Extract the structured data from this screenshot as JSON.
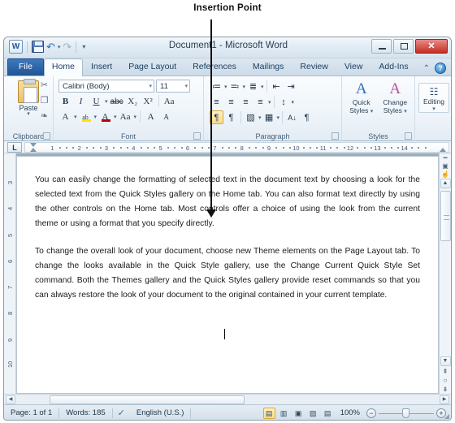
{
  "annotation": {
    "label": "Insertion Point"
  },
  "window": {
    "title": "Document1  -  Microsoft Word",
    "quick_access": [
      {
        "name": "word-logo-icon",
        "label": "W"
      },
      {
        "name": "save-icon",
        "label": "Save"
      },
      {
        "name": "undo-icon",
        "label": "↶"
      },
      {
        "name": "redo-icon",
        "label": "↷"
      },
      {
        "name": "customize-qat-icon",
        "label": "▾"
      }
    ],
    "controls": {
      "minimize": "Minimize",
      "restore": "Restore Down",
      "close": "✕"
    }
  },
  "ribbon": {
    "tabs": [
      {
        "label": "File",
        "active": false,
        "is_file": true
      },
      {
        "label": "Home",
        "active": true
      },
      {
        "label": "Insert",
        "active": false
      },
      {
        "label": "Page Layout",
        "active": false
      },
      {
        "label": "References",
        "active": false
      },
      {
        "label": "Mailings",
        "active": false
      },
      {
        "label": "Review",
        "active": false
      },
      {
        "label": "View",
        "active": false
      },
      {
        "label": "Add-Ins",
        "active": false
      }
    ],
    "minimize_ribbon_icon": "⌃",
    "help_label": "?",
    "groups": {
      "clipboard": {
        "label": "Clipboard",
        "paste_label": "Paste",
        "paste_caret": "▾",
        "cut_icon": "✂",
        "copy_icon": "❐",
        "format_painter_icon": "❧",
        "dialog_launcher": "⌐"
      },
      "font": {
        "label": "Font",
        "font_name": "Calibri (Body)",
        "font_size": "11",
        "bold": "B",
        "italic": "I",
        "underline": "U",
        "underline_caret": "▾",
        "strikethrough": "abc",
        "subscript": "X₂",
        "superscript": "X²",
        "clear_formatting": "Aa",
        "text_effects": "A",
        "text_effects_caret": "▾",
        "highlight": "ab",
        "highlight_caret": "▾",
        "font_color": "A",
        "font_color_caret": "▾",
        "change_case": "Aa",
        "change_case_caret": "▾",
        "grow_font": "A",
        "shrink_font": "A",
        "dialog_launcher": "⌐"
      },
      "paragraph": {
        "label": "Paragraph",
        "bullets": "≔",
        "bullets_caret": "▾",
        "numbering": "≕",
        "numbering_caret": "▾",
        "multilevel": "≣",
        "multilevel_caret": "▾",
        "decrease_indent": "⇤",
        "increase_indent": "⇥",
        "align_left": "≡",
        "align_center": "≡",
        "align_right": "≡",
        "justify": "≡",
        "line_spacing": "↕",
        "line_spacing_caret": "▾",
        "ltr_text": "¶",
        "rtl_text": "¶",
        "shading": "▧",
        "shading_caret": "▾",
        "borders": "▦",
        "borders_caret": "▾",
        "sort": "A↓",
        "show_marks": "¶",
        "dialog_launcher": "⌐"
      },
      "styles": {
        "label": "Styles",
        "quick_styles_line1": "Quick",
        "quick_styles_line2": "Styles",
        "change_styles_line1": "Change",
        "change_styles_line2": "Styles",
        "caret": "▾",
        "dialog_launcher": "⌐"
      },
      "editing": {
        "label": "Editing",
        "editing_label": "Editing",
        "editing_icon": "🔍",
        "caret": "▾"
      }
    }
  },
  "ruler": {
    "tab_selector": "L",
    "horizontal_ticks": [
      "1",
      "2",
      "3",
      "4",
      "5",
      "6",
      "7",
      "8",
      "9",
      "10",
      "11",
      "12",
      "13",
      "14"
    ],
    "vertical_ticks": [
      "3",
      "4",
      "5",
      "6",
      "7",
      "8",
      "9",
      "10"
    ]
  },
  "document": {
    "paragraphs": [
      "You can easily change the formatting of selected text in the document text by choosing a look for the selected text from the Quick Styles gallery on the Home tab. You can also format text directly by using the other controls on the Home tab. Most controls offer a choice of using the look from the current theme or using a format that you specify directly.",
      "To change the overall look of your document, choose new Theme elements on the Page Layout tab. To change the looks available in the Quick Style gallery, use the Change Current Quick Style Set command. Both the Themes gallery and the Quick Styles gallery provide reset commands so that you can always restore the look of your document to the original contained in your current template."
    ]
  },
  "scrollbar": {
    "up_arrow": "▲",
    "down_arrow": "▼",
    "previous_page": "⇞",
    "select_browse_object": "○",
    "next_page": "⇟",
    "left_arrow": "◀",
    "right_arrow": "▶"
  },
  "status_bar": {
    "page": "Page: 1 of 1",
    "words": "Words: 185",
    "proofing_icon": "✓",
    "language": "English (U.S.)",
    "views": [
      {
        "name": "print-layout",
        "glyph": "▤",
        "active": true
      },
      {
        "name": "full-screen-reading",
        "glyph": "▥",
        "active": false
      },
      {
        "name": "web-layout",
        "glyph": "▣",
        "active": false
      },
      {
        "name": "outline",
        "glyph": "▨",
        "active": false
      },
      {
        "name": "draft",
        "glyph": "▤",
        "active": false
      }
    ],
    "zoom_level": "100%",
    "zoom_out": "−",
    "zoom_in": "+"
  },
  "colors": {
    "file_tab_blue": "#1f5595",
    "close_red": "#c32e24",
    "highlight_gold": "#f7e08f",
    "accent_text": "#22384c"
  }
}
